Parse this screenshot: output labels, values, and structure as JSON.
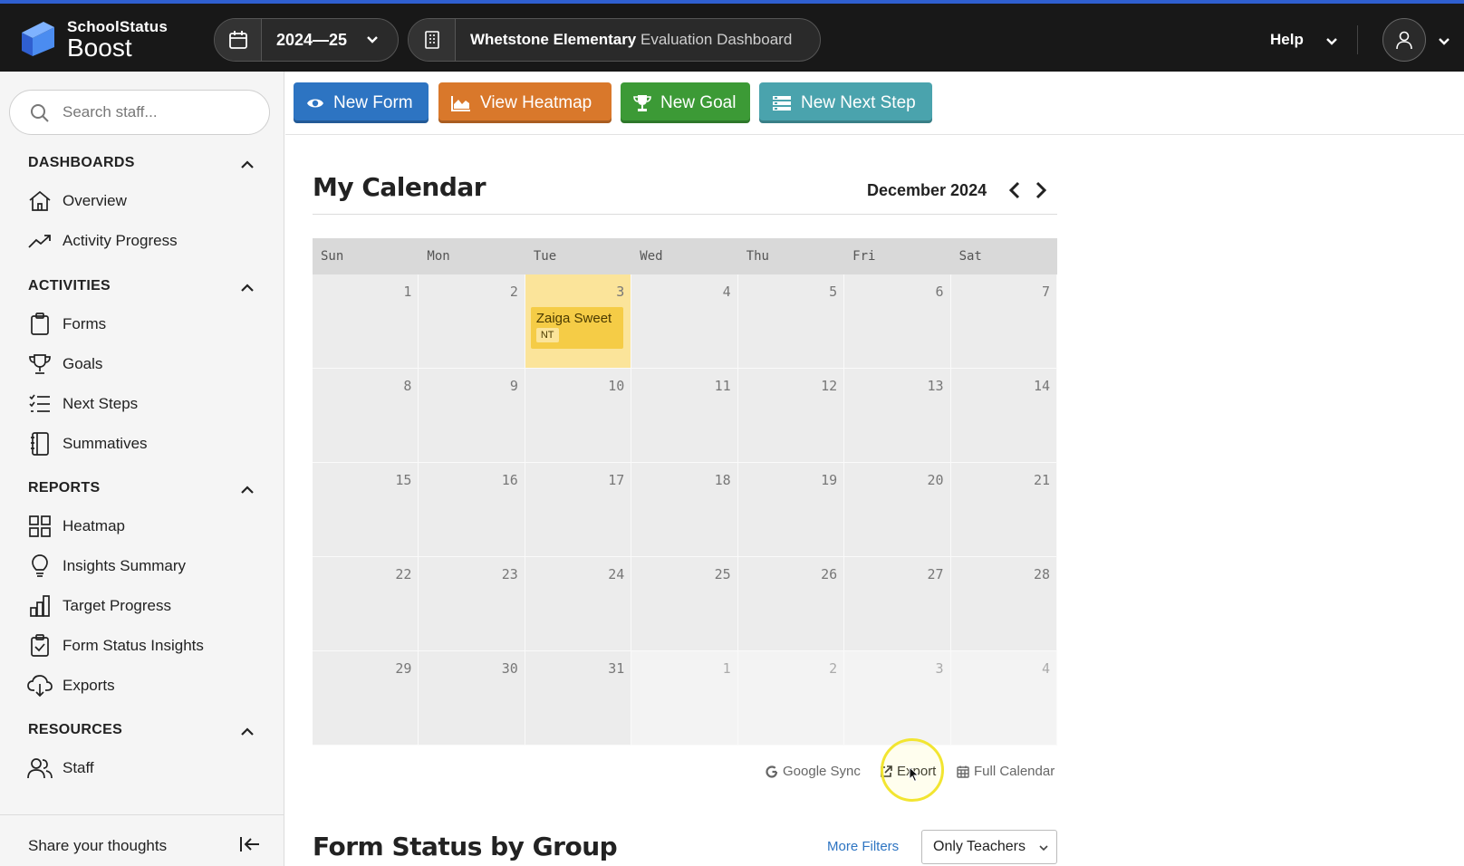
{
  "colors": {
    "accent_bar": "#2f5fd0",
    "topbar_bg": "#181818",
    "btn_new_form": "#2d74c2",
    "btn_view_heatmap": "#d9782b",
    "btn_new_goal": "#3c9a36",
    "btn_new_next_step": "#4aa3ad",
    "event_bg": "#f5cc46",
    "today_bg": "#fbe49a",
    "link_blue": "#2d74c2"
  },
  "header": {
    "brand_line1": "SchoolStatus",
    "brand_line2": "Boost",
    "year": "2024—25",
    "school_name": "Whetstone Elementary",
    "dashboard_name": "Evaluation Dashboard",
    "help_label": "Help"
  },
  "sidebar": {
    "search_placeholder": "Search staff...",
    "sections": [
      {
        "title": "DASHBOARDS",
        "items": [
          {
            "label": "Overview",
            "icon": "home-icon"
          },
          {
            "label": "Activity Progress",
            "icon": "trending-up-icon"
          }
        ]
      },
      {
        "title": "ACTIVITIES",
        "items": [
          {
            "label": "Forms",
            "icon": "clipboard-icon"
          },
          {
            "label": "Goals",
            "icon": "trophy-icon"
          },
          {
            "label": "Next Steps",
            "icon": "list-icon"
          },
          {
            "label": "Summatives",
            "icon": "notebook-icon"
          }
        ]
      },
      {
        "title": "REPORTS",
        "items": [
          {
            "label": "Heatmap",
            "icon": "grid-icon"
          },
          {
            "label": "Insights Summary",
            "icon": "lightbulb-icon"
          },
          {
            "label": "Target Progress",
            "icon": "bar-chart-icon"
          },
          {
            "label": "Form Status Insights",
            "icon": "clipboard-check-icon"
          },
          {
            "label": "Exports",
            "icon": "cloud-download-icon"
          }
        ]
      },
      {
        "title": "RESOURCES",
        "items": [
          {
            "label": "Staff",
            "icon": "users-icon"
          }
        ]
      }
    ],
    "share_label": "Share your thoughts"
  },
  "toolbar": {
    "new_form": "New Form",
    "view_heatmap": "View Heatmap",
    "new_goal": "New Goal",
    "new_next_step": "New Next Step"
  },
  "calendar": {
    "title": "My Calendar",
    "month_label": "December 2024",
    "weekdays": [
      "Sun",
      "Mon",
      "Tue",
      "Wed",
      "Thu",
      "Fri",
      "Sat"
    ],
    "days": [
      "1",
      "2",
      "3",
      "4",
      "5",
      "6",
      "7",
      "8",
      "9",
      "10",
      "11",
      "12",
      "13",
      "14",
      "15",
      "16",
      "17",
      "18",
      "19",
      "20",
      "21",
      "22",
      "23",
      "24",
      "25",
      "26",
      "27",
      "28",
      "29",
      "30",
      "31",
      "1",
      "2",
      "3",
      "4"
    ],
    "first_trailing_index": 31,
    "today_index": 2,
    "events": [
      {
        "day_index": 2,
        "name": "Zaiga Sweet",
        "tag": "NT"
      }
    ],
    "links": {
      "google_sync": "Google Sync",
      "export": "Export",
      "full_calendar": "Full Calendar"
    }
  },
  "form_status": {
    "title": "Form Status by Group",
    "more_filters": "More Filters",
    "filter_value": "Only Teachers"
  }
}
